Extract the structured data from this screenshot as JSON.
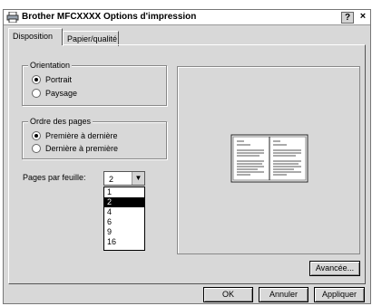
{
  "window": {
    "title": "Brother MFCXXXX Options d'impression",
    "help_label": "?",
    "close_label": "×"
  },
  "tabs": [
    {
      "label": "Disposition",
      "active": true
    },
    {
      "label": "Papier/qualité",
      "active": false
    }
  ],
  "orientation": {
    "title": "Orientation",
    "options": [
      {
        "label": "Portrait",
        "selected": true
      },
      {
        "label": "Paysage",
        "selected": false
      }
    ]
  },
  "page_order": {
    "title": "Ordre des pages",
    "options": [
      {
        "label": "Première à dernière",
        "selected": true
      },
      {
        "label": "Dernière à première",
        "selected": false
      }
    ]
  },
  "pages_per_sheet": {
    "label": "Pages par feuille:",
    "value": "2",
    "options": [
      "1",
      "2",
      "4",
      "6",
      "9",
      "16"
    ],
    "highlighted": "2"
  },
  "buttons": {
    "advanced": "Avancée...",
    "ok": "OK",
    "cancel": "Annuler",
    "apply": "Appliquer"
  },
  "icons": {
    "window": "printer-icon",
    "dropdown": "chevron-down-icon"
  }
}
